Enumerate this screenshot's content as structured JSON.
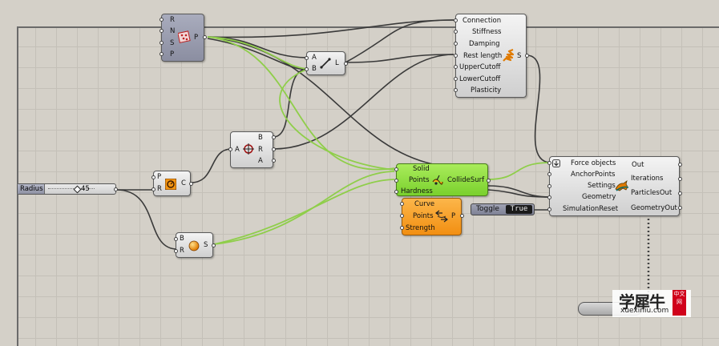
{
  "slider": {
    "label": "Radius",
    "value": "45"
  },
  "toggle": {
    "label": "Toggle",
    "value": "True"
  },
  "components": {
    "mesh": {
      "inputs": [
        "R",
        "N",
        "S",
        "P"
      ],
      "outputs": [
        "P"
      ]
    },
    "line": {
      "inputs": [
        "A",
        "B"
      ],
      "outputs": [
        "L"
      ]
    },
    "circle_cnr": {
      "inputs": [
        "A"
      ],
      "outputs": [
        "B",
        "R",
        "A"
      ]
    },
    "pc": {
      "inputs": [
        "P",
        "R"
      ],
      "outputs": [
        "C"
      ]
    },
    "sphere": {
      "inputs": [
        "B",
        "R"
      ],
      "outputs": [
        "S"
      ]
    },
    "springs": {
      "inputs": [
        "Connection",
        "Stiffness",
        "Damping",
        "Rest length",
        "UpperCutoff",
        "LowerCutoff",
        "Plasticity"
      ],
      "outputs": [
        "S"
      ]
    },
    "collide": {
      "inputs": [
        "Solid",
        "Points",
        "Hardness"
      ],
      "outputs": [
        "CollideSurf"
      ]
    },
    "curve_pull": {
      "inputs": [
        "Curve",
        "Points",
        "Strength"
      ],
      "outputs": [
        "P"
      ]
    },
    "kangaroo": {
      "inputs": [
        "Force objects",
        "AnchorPoints",
        "Settings",
        "Geometry",
        "SimulationReset"
      ],
      "outputs": [
        "Out",
        "Iterations",
        "ParticlesOut",
        "GeometryOut"
      ]
    }
  },
  "watermark": {
    "text": "学犀牛",
    "seal": "中文网",
    "url": "xuexiniu.com"
  },
  "colors": {
    "canvas": "#d4d0c8",
    "wire": "#3a3a3a",
    "selected_wire": "#8fce4a",
    "green_comp": "#8add3c",
    "orange_comp": "#f6a021"
  }
}
